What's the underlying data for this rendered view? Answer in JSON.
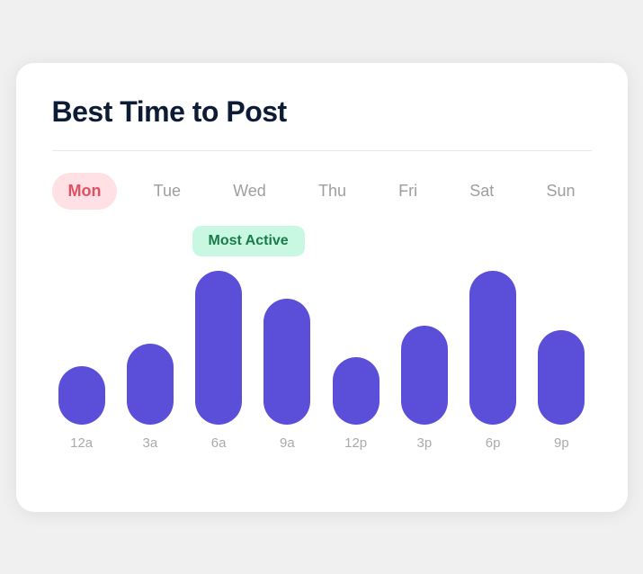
{
  "card": {
    "title": "Best Time to Post"
  },
  "days": [
    {
      "label": "Mon",
      "active": true
    },
    {
      "label": "Tue",
      "active": false
    },
    {
      "label": "Wed",
      "active": false
    },
    {
      "label": "Thu",
      "active": false
    },
    {
      "label": "Fri",
      "active": false
    },
    {
      "label": "Sat",
      "active": false
    },
    {
      "label": "Sun",
      "active": false
    }
  ],
  "most_active_label": "Most Active",
  "bars": [
    {
      "label": "12a",
      "height": 65
    },
    {
      "label": "3a",
      "height": 90
    },
    {
      "label": "6a",
      "height": 185
    },
    {
      "label": "9a",
      "height": 140
    },
    {
      "label": "12p",
      "height": 75
    },
    {
      "label": "3p",
      "height": 110
    },
    {
      "label": "6p",
      "height": 175
    },
    {
      "label": "9p",
      "height": 105
    }
  ]
}
